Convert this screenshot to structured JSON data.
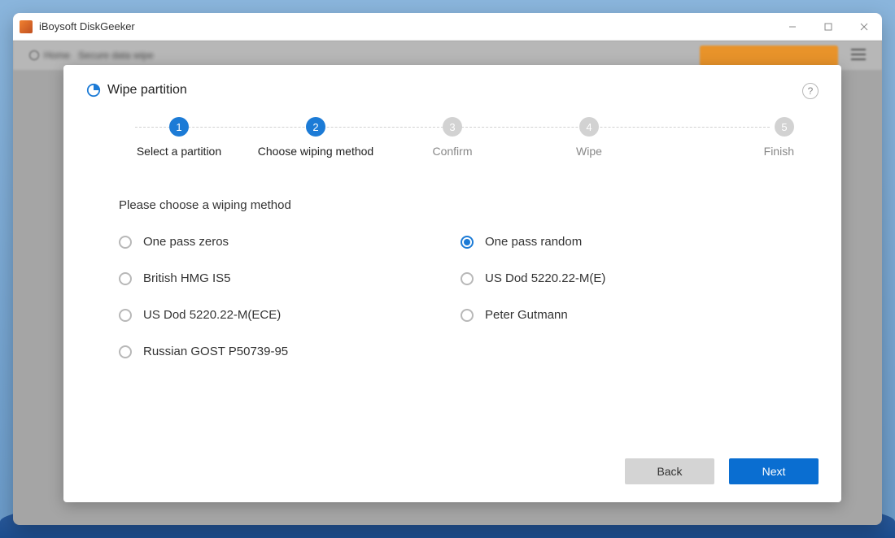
{
  "window": {
    "title": "iBoysoft DiskGeeker"
  },
  "dialog": {
    "title": "Wipe partition",
    "help_symbol": "?",
    "steps": [
      {
        "num": "1",
        "label": "Select a partition",
        "active": true
      },
      {
        "num": "2",
        "label": "Choose wiping method",
        "active": true
      },
      {
        "num": "3",
        "label": "Confirm",
        "active": false
      },
      {
        "num": "4",
        "label": "Wipe",
        "active": false
      },
      {
        "num": "5",
        "label": "Finish",
        "active": false
      }
    ],
    "prompt": "Please choose a wiping method",
    "options_left": [
      {
        "label": "One pass zeros",
        "selected": false
      },
      {
        "label": "British HMG IS5",
        "selected": false
      },
      {
        "label": "US Dod 5220.22-M(ECE)",
        "selected": false
      },
      {
        "label": "Russian GOST P50739-95",
        "selected": false
      }
    ],
    "options_right": [
      {
        "label": "One pass random",
        "selected": true
      },
      {
        "label": "US Dod 5220.22-M(E)",
        "selected": false
      },
      {
        "label": "Peter Gutmann",
        "selected": false
      }
    ],
    "buttons": {
      "back": "Back",
      "next": "Next"
    }
  }
}
